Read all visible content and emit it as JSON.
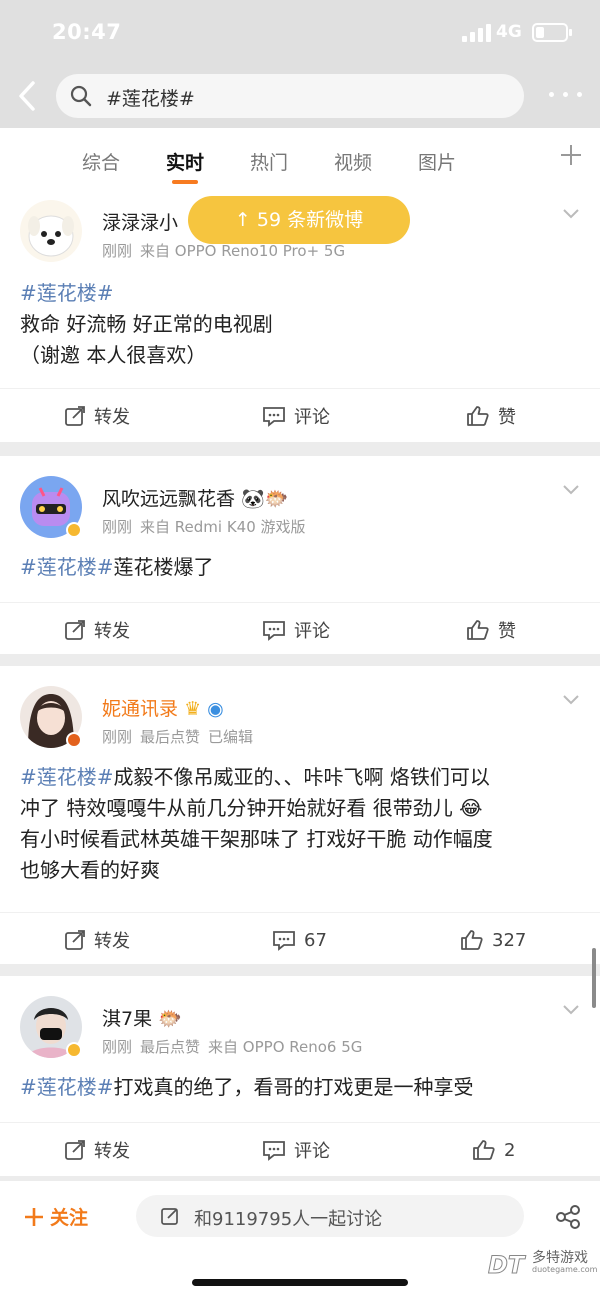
{
  "status": {
    "time": "20:47",
    "network": "4G"
  },
  "search": {
    "query": "#莲花楼#"
  },
  "tabs": [
    "综合",
    "实时",
    "热门",
    "视频",
    "图片"
  ],
  "new_posts_pill": "↑ 59 条新微博",
  "posts": [
    {
      "username": "渌渌渌小",
      "time": "刚刚",
      "source": "来自 OPPO Reno10 Pro+ 5G",
      "tag": "#莲花楼#",
      "lines": [
        "救命 好流畅 好正常的电视剧",
        "（谢邀 本人很喜欢）"
      ],
      "repost": "转发",
      "comment": "评论",
      "like": "赞"
    },
    {
      "username": "风吹远远飘花香",
      "time": "刚刚",
      "source": "来自 Redmi K40 游戏版",
      "tag": "#莲花楼#",
      "text": "莲花楼爆了",
      "repost": "转发",
      "comment": "评论",
      "like": "赞"
    },
    {
      "username": "妮通讯录",
      "time": "刚刚",
      "extra1": "最后点赞",
      "extra2": "已编辑",
      "tag": "#莲花楼#",
      "line1": "成毅不像吊威亚的、、咔咔飞啊 烙铁们可以",
      "line2": "冲了 特效嘎嘎牛从前几分钟开始就好看 很带劲儿",
      "line3": "有小时候看武林英雄干架那味了 打戏好干脆 动作幅度",
      "line4": "也够大看的好爽",
      "repost": "转发",
      "comment": "67",
      "like": "327"
    },
    {
      "username": "淇7果",
      "time": "刚刚",
      "extra1": "最后点赞",
      "source": "来自 OPPO Reno6 5G",
      "tag": "#莲花楼#",
      "text": "打戏真的绝了，看哥的打戏更是一种享受",
      "repost": "转发",
      "comment": "评论",
      "like": "2"
    }
  ],
  "bottom": {
    "follow": "关注",
    "discuss": "和9119795人一起讨论"
  },
  "watermark": {
    "name": "多特游戏",
    "url": "duotegame.com"
  },
  "colors": {
    "accent": "#f27a1a",
    "tag": "#5b7fb5",
    "pill": "#f6c53f",
    "header": "#e0e0e0"
  }
}
